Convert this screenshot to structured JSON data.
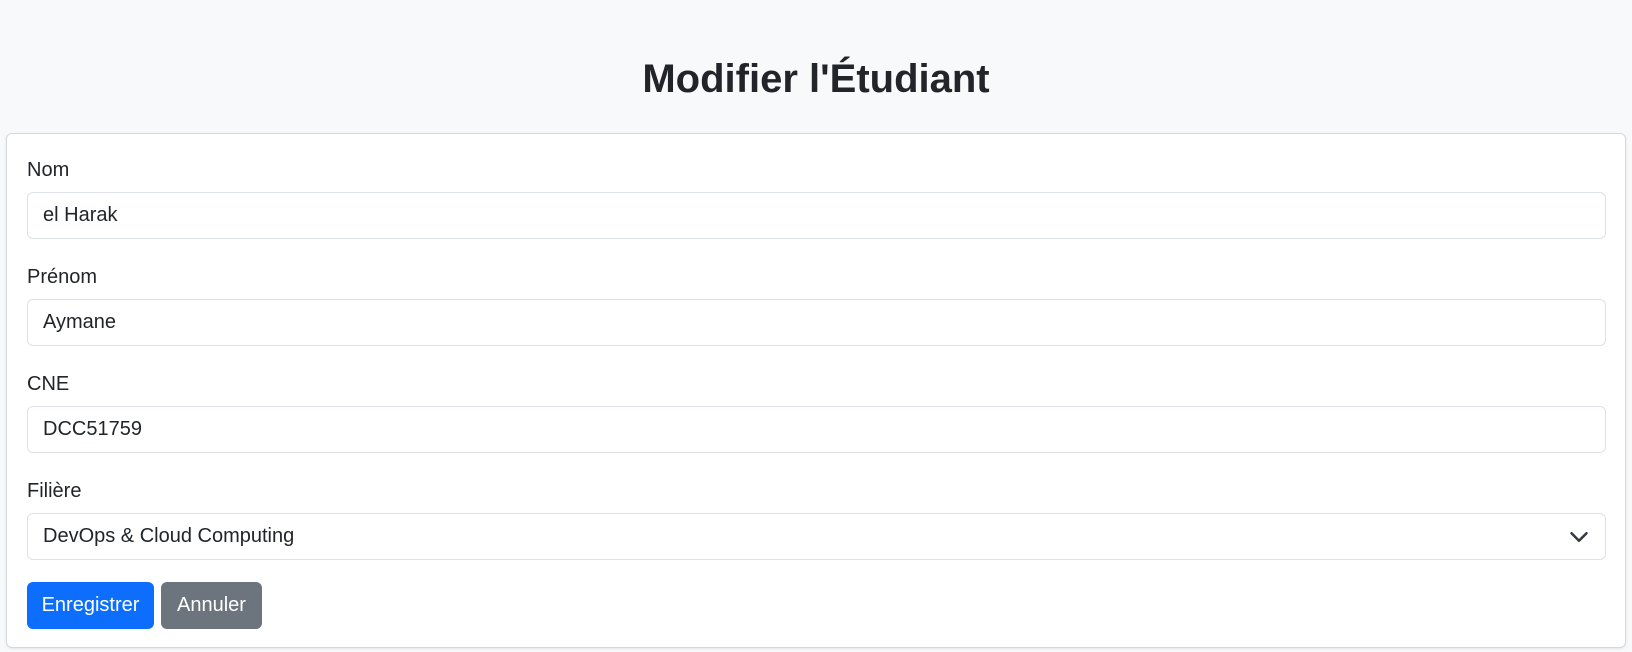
{
  "page": {
    "title": "Modifier l'Étudiant"
  },
  "form": {
    "nom": {
      "label": "Nom",
      "value": "el Harak"
    },
    "prenom": {
      "label": "Prénom",
      "value": "Aymane"
    },
    "cne": {
      "label": "CNE",
      "value": "DCC51759"
    },
    "filiere": {
      "label": "Filière",
      "selected": "DevOps & Cloud Computing"
    }
  },
  "actions": {
    "save_label": "Enregistrer",
    "cancel_label": "Annuler"
  },
  "icons": {
    "select": "chevron-down-icon"
  },
  "colors": {
    "primary": "#0d6efd",
    "secondary": "#6c757d",
    "background": "#f8f9fa"
  }
}
